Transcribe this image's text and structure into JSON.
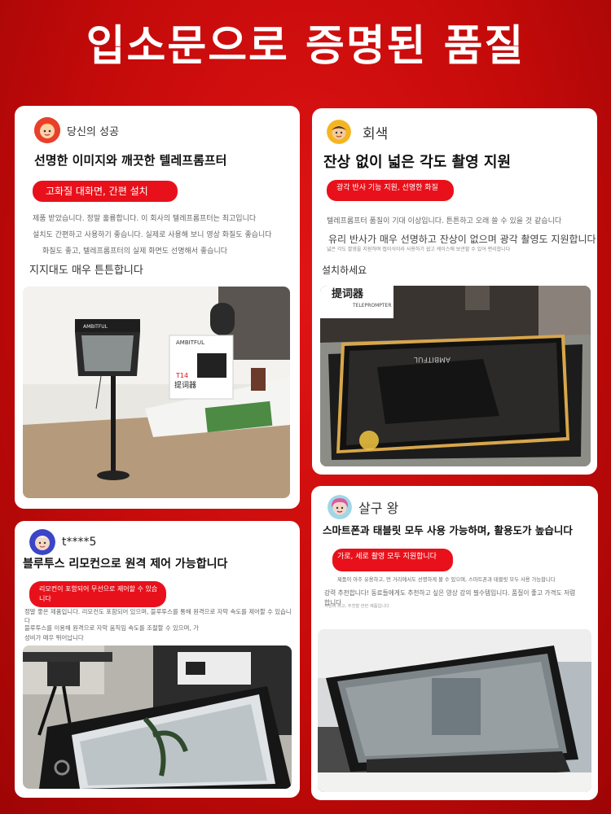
{
  "headline": "입소문으로 증명된 품질",
  "reviews": [
    {
      "user": "당신의 성공",
      "title": "선명한 이미지와 깨끗한 텔레프롬프터",
      "tag": "고화질 대화면, 간편 설치",
      "lines": [
        "제품 받았습니다. 정말 훌륭합니다. 이 회사의 텔레프롬프터는 최고입니다",
        "설치도 간편하고 사용하기 좋습니다. 실제로 사용해 보니 영상 화질도 좋습니다",
        "화질도 좋고, 텔레프롬프터의 실제 화면도 선명해서 좋습니다"
      ],
      "closing": "지지대도 매우 튼튼합니다",
      "photo": {
        "box_brand": "AMBITFUL",
        "box_model": "T14",
        "box_name": "提词器",
        "device_label": "AMBITFUL"
      }
    },
    {
      "user": "회색",
      "title": "잔상 없이 넓은 각도 촬영 지원",
      "tag": "광각 반사 기능 지원, 선명한 화질",
      "lines": [
        "텔레프롬프터 품질이 기대 이상입니다. 튼튼하고 오래 쓸 수 있을 것 같습니다"
      ],
      "emphasis": "유리 반사가 매우 선명하고 잔상이 없으며 광각 촬영도 지원합니다",
      "small": "넓은 각도 촬영을 지원하며 접이식이라 사용하기 쉽고 케이스에 보관할 수 있어 편리합니다",
      "closing": "설치하세요",
      "photo": {
        "box_text": "提词器",
        "box_sub": "TELEPROMPTER",
        "mirror_label": "AMBITFUL"
      }
    },
    {
      "user": "t****5",
      "title": "블루투스 리모컨으로 원격 제어 가능합니다",
      "tag": "리모컨이 포함되어 무선으로 제어할 수 있습니다",
      "lines": [
        "정말 좋은 제품입니다. 리모컨도 포함되어 있으며, 블루투스를 통해 원격으로 자막 속도를 제어할 수 있습니다",
        "블루투스를 이용해 원격으로 자막 움직임 속도를 조절할 수 있으며, 가",
        "성비가 매우 뛰어납니다"
      ]
    },
    {
      "user": "살구 왕",
      "title": "스마트폰과 태블릿 모두 사용 가능하며, 활용도가 높습니다",
      "tag": "가로, 세로 촬영 모두 지원합니다",
      "lines": [
        "제품이 아주 유용하고, 먼 거리에서도 선명하게 볼 수 있으며, 스마트폰과 태블릿 모두 사용 가능합니다",
        "강력 추천합니다! 동료들에게도 추천하고 싶은 영상 강의 필수템입니다. 품질이 좋고 가격도 저렴합니다",
        "가성비 최고, 추천할 만한 제품입니다"
      ]
    }
  ],
  "colors": {
    "accent": "#e8111b",
    "background": "#c40a0a"
  }
}
